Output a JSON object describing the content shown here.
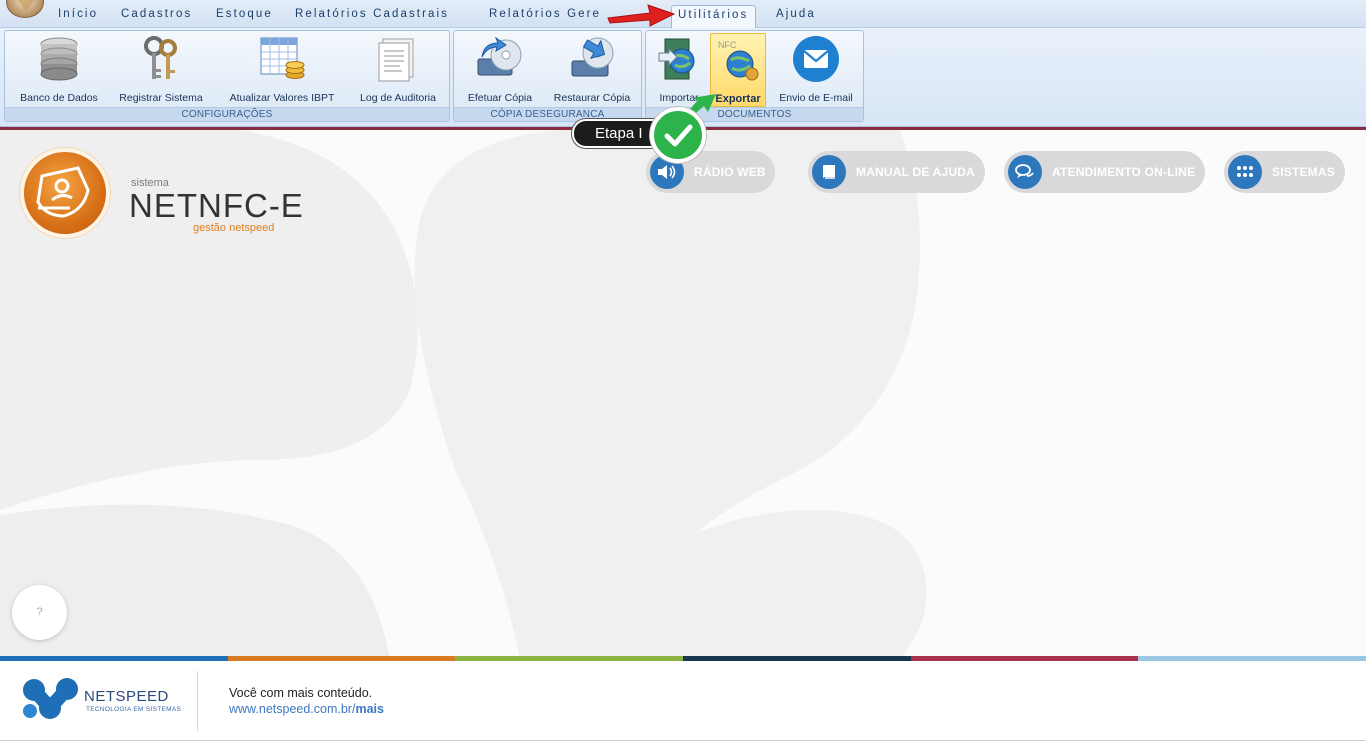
{
  "menu": {
    "tabs": [
      "Início",
      "Cadastros",
      "Estoque",
      "Relatórios Cadastrais",
      "Relatórios Gerenciais",
      "Utilitários",
      "Ajuda"
    ],
    "active_tab": "Utilitários",
    "clipped_tab_text": "Relatórios Gere"
  },
  "ribbon": {
    "groups": [
      {
        "label": "CONFIGURAÇÕES",
        "buttons": [
          "Banco de Dados",
          "Registrar Sistema",
          "Atualizar Valores IBPT",
          "Log de Auditoria"
        ]
      },
      {
        "label": "CÓPIA DESEGURANCA",
        "buttons": [
          "Efetuar Cópia",
          "Restaurar Cópia"
        ]
      },
      {
        "label": "DOCUMENTOS",
        "buttons": [
          "Importar",
          "Exportar",
          "Envio de E-mail"
        ]
      }
    ]
  },
  "annotation": {
    "callout_text": "Etapa I"
  },
  "brand": {
    "small_label": "sistema",
    "name": "NETNFC-E",
    "subtitle": "gestão netspeed",
    "orange": "#e07f1e"
  },
  "quick_links": [
    "RÁDIO WEB",
    "MANUAL DE AJUDA",
    "ATENDIMENTO ON-LINE",
    "SISTEMAS"
  ],
  "help_button": "?",
  "footer": {
    "company": "NETSPEED",
    "tagline": "TECNOLOGIA EM SISTEMAS",
    "message": "Você com mais conteúdo.",
    "link_prefix": "www.netspeed.com.br/",
    "link_bold": "mais",
    "stripe_colors": [
      "#1e6fb5",
      "#d97b23",
      "#8db440",
      "#173652",
      "#a8324a",
      "#9cc6e6"
    ]
  },
  "icons": {
    "banco": "database-icon",
    "registrar": "keys-icon",
    "ibpt": "spreadsheet-coins-icon",
    "log": "document-icon",
    "efetuar": "backup-disc-icon",
    "restaurar": "restore-disc-icon",
    "importar": "import-icon",
    "exportar": "export-icon",
    "email": "envelope-icon",
    "radio": "speaker-icon",
    "manual": "book-icon",
    "atendimento": "chat-icon",
    "sistemas": "grid-dots-icon"
  }
}
